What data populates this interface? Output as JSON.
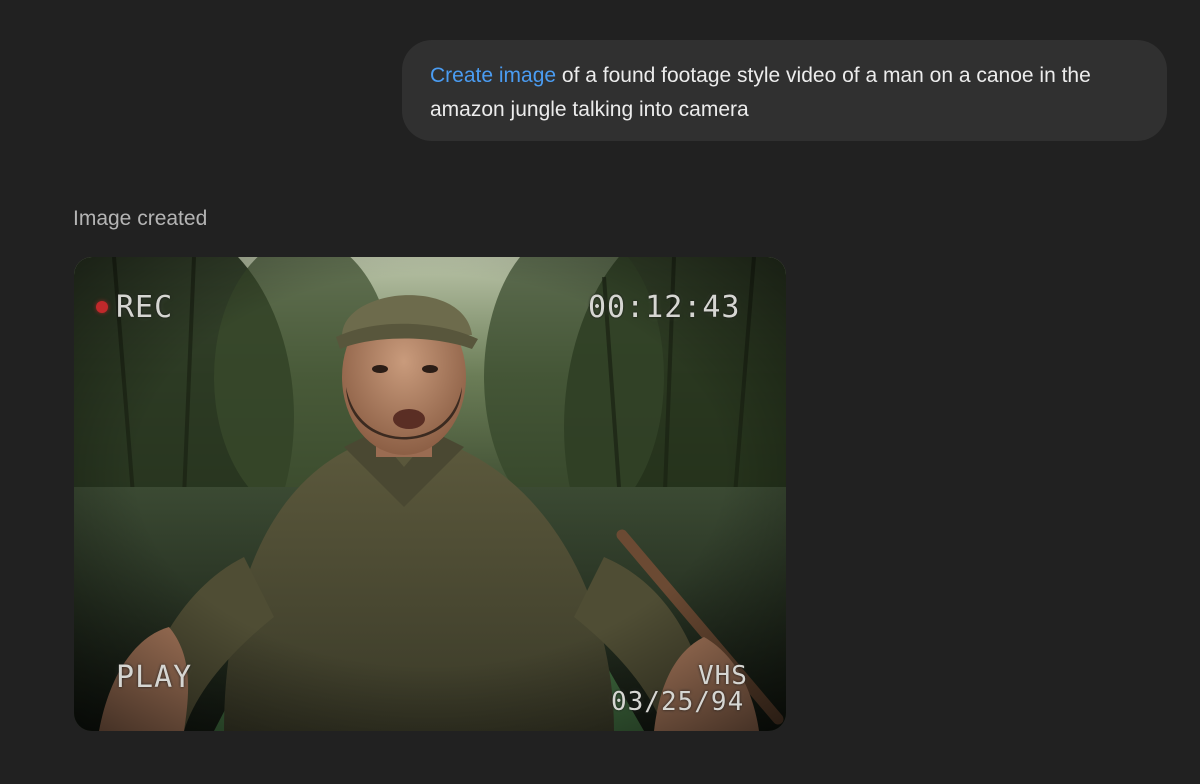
{
  "message": {
    "tool_label": "Create image",
    "prompt_text": " of a found footage style video of a man on a canoe in the amazon jungle talking into camera"
  },
  "status": "Image created",
  "overlay": {
    "rec": "REC",
    "timecode": "00:12:43",
    "mode": "PLAY",
    "format": "VHS",
    "date": "03/25/94"
  },
  "colors": {
    "background": "#212121",
    "bubble": "#303030",
    "tool_accent": "#4a9cf2",
    "rec_dot": "#c0292b"
  }
}
